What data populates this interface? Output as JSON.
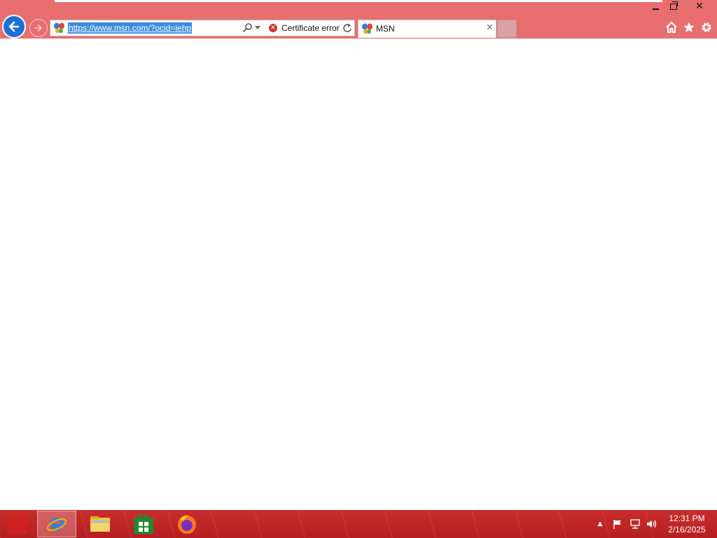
{
  "window": {
    "minimize_label": "",
    "close_label": "✕"
  },
  "address_bar": {
    "url": "https://www.msn.com/?ocid=iehp",
    "certificate_status": "Certificate error"
  },
  "tab": {
    "title": "MSN",
    "close_label": "✕"
  },
  "toolbar_icons": [
    "home-icon",
    "favorites-star-icon",
    "settings-gear-icon"
  ],
  "taskbar": {
    "apps": [
      "internet-explorer-icon",
      "file-explorer-icon",
      "store-icon",
      "firefox-icon"
    ],
    "clock_time": "12:31 PM",
    "clock_date": "2/16/2025"
  },
  "colors": {
    "chrome_accent": "#e86e70",
    "back_button": "#1e6fd2",
    "url_selection": "#3b8bdf",
    "taskbar": "#c92d2d"
  }
}
